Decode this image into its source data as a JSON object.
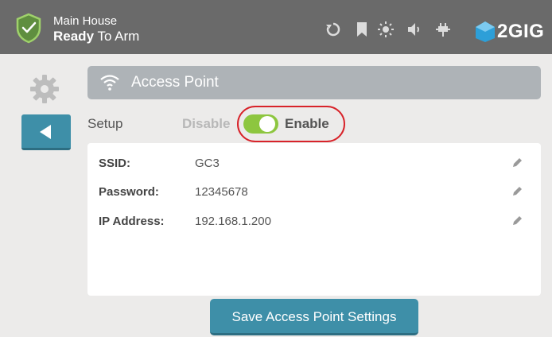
{
  "header": {
    "location": "Main House",
    "status_bold": "Ready",
    "status_rest": " To Arm",
    "logo_text": "2GIG"
  },
  "page": {
    "title": "Access Point",
    "setup_label": "Setup",
    "disable_label": "Disable",
    "enable_label": "Enable",
    "toggle_state": "enabled"
  },
  "fields": [
    {
      "label": "SSID:",
      "value": "GC3"
    },
    {
      "label": "Password:",
      "value": "12345678"
    },
    {
      "label": "IP Address:",
      "value": "192.168.1.200"
    }
  ],
  "actions": {
    "save_label": "Save Access Point Settings"
  },
  "colors": {
    "header_bg": "#6a6a6a",
    "accent_teal": "#3e8fa8",
    "toggle_green": "#8dc63f",
    "highlight_red": "#d8232a"
  },
  "icons": [
    "shield-check-icon",
    "refresh-icon",
    "bookmark-icon",
    "brightness-icon",
    "volume-icon",
    "power-plug-icon",
    "gear-icon",
    "back-arrow-icon",
    "wifi-icon",
    "pencil-icon"
  ]
}
